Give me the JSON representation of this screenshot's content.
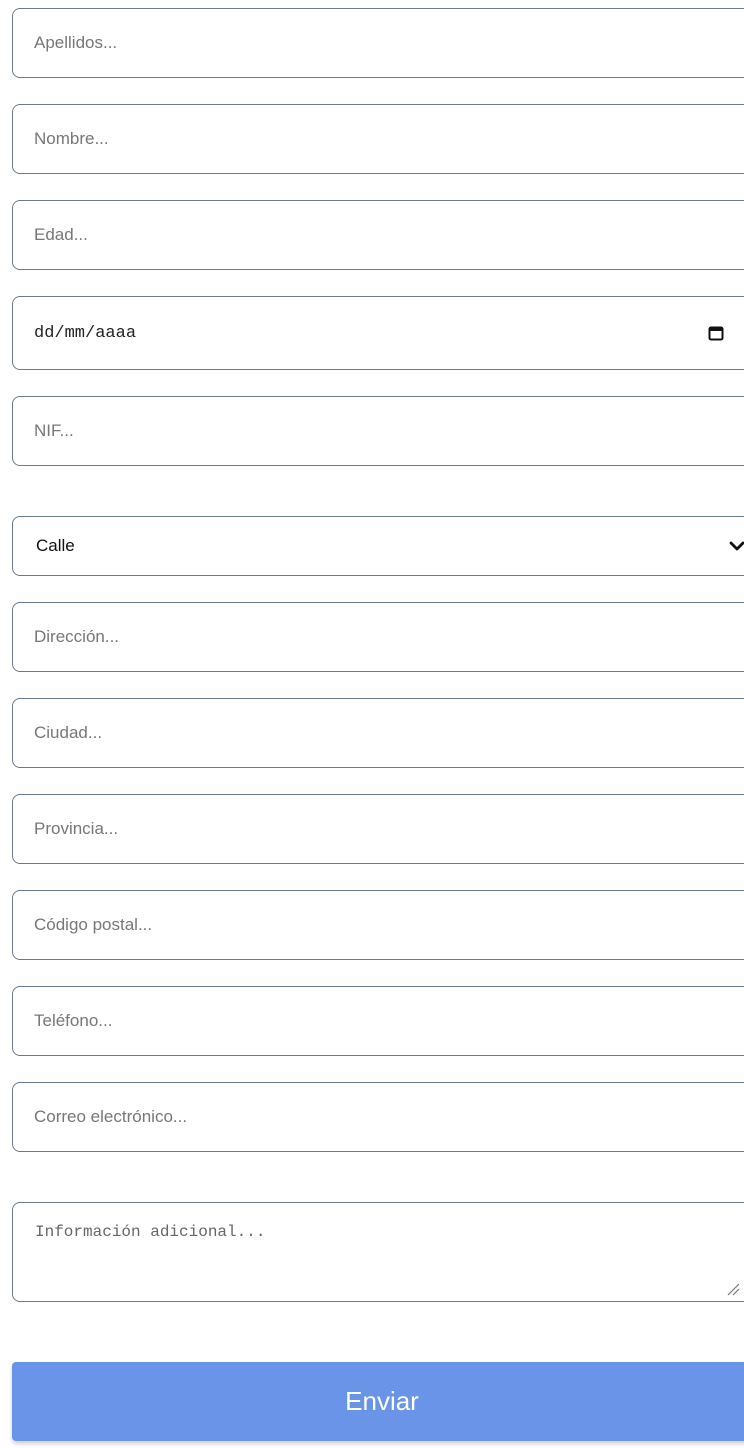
{
  "form": {
    "apellidos_placeholder": "Apellidos...",
    "nombre_placeholder": "Nombre...",
    "edad_placeholder": "Edad...",
    "fecha_placeholder": "dd/mm/aaaa",
    "nif_placeholder": "NIF...",
    "via_selected": "Calle",
    "direccion_placeholder": "Dirección...",
    "ciudad_placeholder": "Ciudad...",
    "provincia_placeholder": "Provincia...",
    "codigo_postal_placeholder": "Código postal...",
    "telefono_placeholder": "Teléfono...",
    "correo_placeholder": "Correo electrónico...",
    "info_adicional_placeholder": "Información adicional...",
    "submit_label": "Enviar"
  },
  "icons": {
    "date": "calendar-icon",
    "select": "chevron-down-icon",
    "textarea": "resize-handle-icon"
  },
  "colors": {
    "submit_background": "#6a94e8",
    "field_border": "#6b7a8c"
  }
}
